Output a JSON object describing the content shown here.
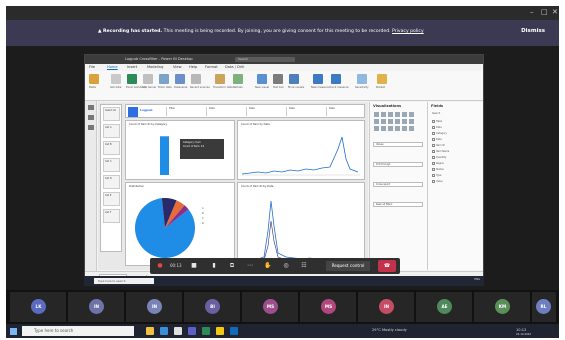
{
  "recording_banner": {
    "title": "Recording has started.",
    "message": "This meeting is being recorded. By joining, you are giving consent for this meeting to be recorded.",
    "link": "Privacy policy",
    "dismiss": "Dismiss"
  },
  "powerbi": {
    "title": "Logpub Crossfilter - Power BI Desktop",
    "search_placeholder": "Search",
    "tabs": [
      "File",
      "Home",
      "Insert",
      "Modeling",
      "View",
      "Help",
      "Format",
      "Data / Drill"
    ],
    "ribbon_labels": [
      "Paste",
      "Get data",
      "Excel workbook",
      "SQL Server",
      "Enter data",
      "Dataverse",
      "Recent sources",
      "Transform data",
      "Refresh",
      "New visual",
      "Text box",
      "More visuals",
      "New measure",
      "Quick measure",
      "Sensitivity",
      "Publish"
    ],
    "header": {
      "brand": "Logpub",
      "fields": [
        "Filter",
        "Data",
        "Date",
        "Date",
        "Date"
      ]
    },
    "slicer_items": [
      "Select all",
      "Cat A",
      "Cat B",
      "Cat C",
      "Cat D",
      "Cat E",
      "Cat F"
    ],
    "visuals": {
      "bar_title": "Count of Item ID by Category",
      "line_title": "Count of Item by Date",
      "pie_title": "Distribution",
      "line2_title": "Count of Item ID by Date"
    },
    "tooltip_lines": [
      "Category: Sum",
      "Count of Item: 44"
    ],
    "pages_label": "Overview",
    "page_indicator": "Page 1 of 1",
    "visualizations_title": "Visualizations",
    "fields_title": "Fields",
    "field_names": [
      "Search",
      "Table",
      "Data",
      "Category",
      "Date",
      "Item ID",
      "Item Name",
      "Quantity",
      "Region",
      "Status",
      "Type",
      "Value"
    ],
    "viz_pane_labels": [
      "Values",
      "Drill through",
      "Cross-report",
      "Keep all filters"
    ]
  },
  "meeting_bar": {
    "timer": "00:13",
    "request_control": "Request control"
  },
  "inner_taskbar": {
    "search": "Type here to search",
    "tray": "ENG"
  },
  "participants": [
    {
      "initials": "LK",
      "color": "#5b6bbf"
    },
    {
      "initials": "IN",
      "color": "#6d74a8"
    },
    {
      "initials": "IN",
      "color": "#7983b6"
    },
    {
      "initials": "BI",
      "color": "#6a5fa0"
    },
    {
      "initials": "MS",
      "color": "#9b4f8c"
    },
    {
      "initials": "MS",
      "color": "#b0477d"
    },
    {
      "initials": "IN",
      "color": "#c24d64"
    },
    {
      "initials": "AE",
      "color": "#4f8a5c"
    },
    {
      "initials": "KM",
      "color": "#5b8f5a"
    },
    {
      "initials": "RL",
      "color": "#6d7fc0"
    }
  ],
  "win_taskbar": {
    "search": "Type here to search",
    "weather": "29°C Mostly cloudy",
    "time": "10:12",
    "date": "24-10-2022"
  },
  "chart_data": [
    {
      "type": "bar",
      "title": "Count of Item ID by Category",
      "categories": [
        "Cat 1"
      ],
      "values": [
        44
      ]
    },
    {
      "type": "pie",
      "title": "Distribution",
      "categories": [
        "A",
        "B",
        "C",
        "D"
      ],
      "values": [
        84,
        8,
        5,
        3
      ]
    }
  ]
}
